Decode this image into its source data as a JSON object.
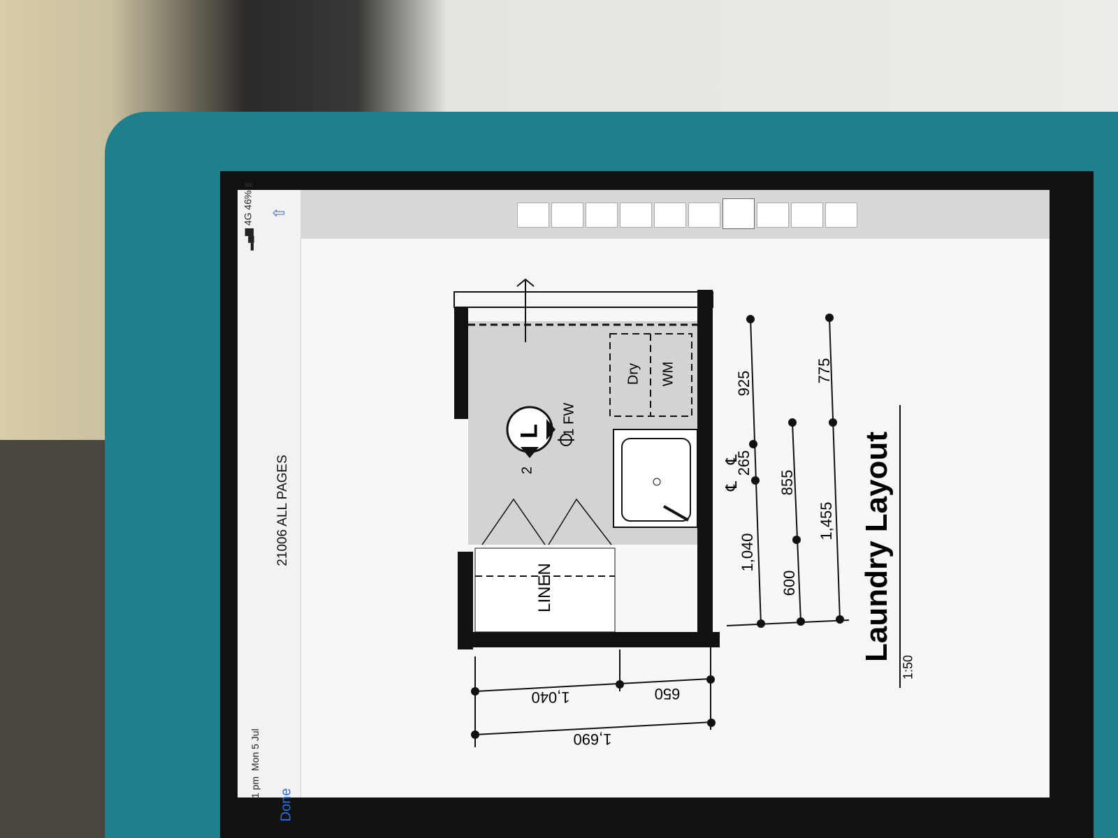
{
  "status_bar": {
    "time": "1 pm",
    "date": "Mon 5 Jul",
    "network": "4G",
    "battery": "46%"
  },
  "nav": {
    "done_label": "Done",
    "title": "21006 ALL PAGES",
    "share_icon": "share-icon"
  },
  "thumbnails": {
    "count": 10,
    "selected_index": 6
  },
  "drawing": {
    "title": "Laundry Layout",
    "scale": "1:50",
    "labels": {
      "linen": "LINEN",
      "dry": "Dry",
      "wm": "WM",
      "fw": "FW",
      "fw_num": "1",
      "callout_letter": "L",
      "callout_num": "2",
      "cl": "℄"
    },
    "dims_right_1": [
      "925",
      "265",
      "1,040"
    ],
    "dims_right_2": [
      "855",
      "600"
    ],
    "dims_right_3": [
      "775",
      "1,455"
    ],
    "dims_bottom": [
      "1,040",
      "650",
      "1,690"
    ]
  },
  "colors": {
    "case": "#1f7f8a",
    "link": "#2a6fdb",
    "floor": "#d3d3d3"
  }
}
